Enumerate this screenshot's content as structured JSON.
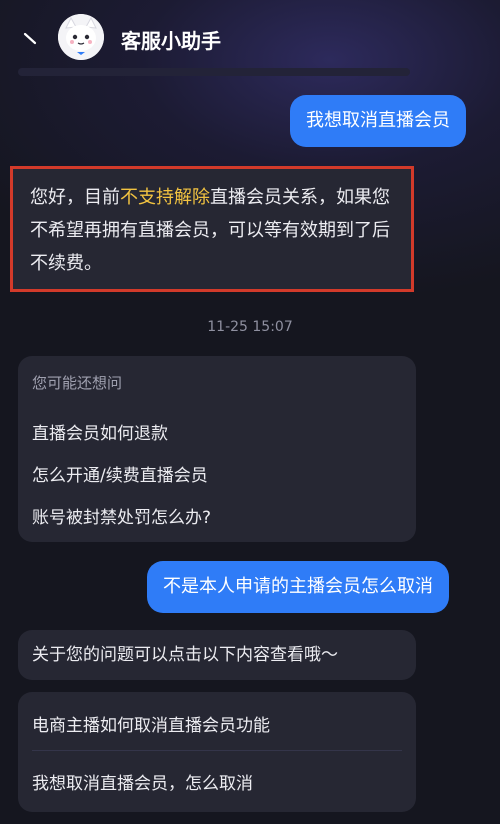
{
  "header": {
    "title": "客服小助手"
  },
  "messages": {
    "user1": "我想取消直播会员",
    "bot1_pre": "您好，目前",
    "bot1_highlight": "不支持解除",
    "bot1_post": "直播会员关系，如果您不希望再拥有直播会员，可以等有效期到了后不续费。",
    "timestamp": "11-25 15:07",
    "user2": "不是本人申请的主播会员怎么取消",
    "bot2": "关于您的问题可以点击以下内容查看哦～"
  },
  "suggestions": {
    "heading": "您可能还想问",
    "items": [
      "直播会员如何退款",
      "怎么开通/续费直播会员",
      "账号被封禁处罚怎么办?"
    ]
  },
  "links": {
    "items": [
      "电商主播如何取消直播会员功能",
      "我想取消直播会员，怎么取消"
    ]
  },
  "colors": {
    "user_bubble": "#2f7cf7",
    "highlight_text": "#f2c341",
    "highlight_border": "#d23a2a"
  }
}
